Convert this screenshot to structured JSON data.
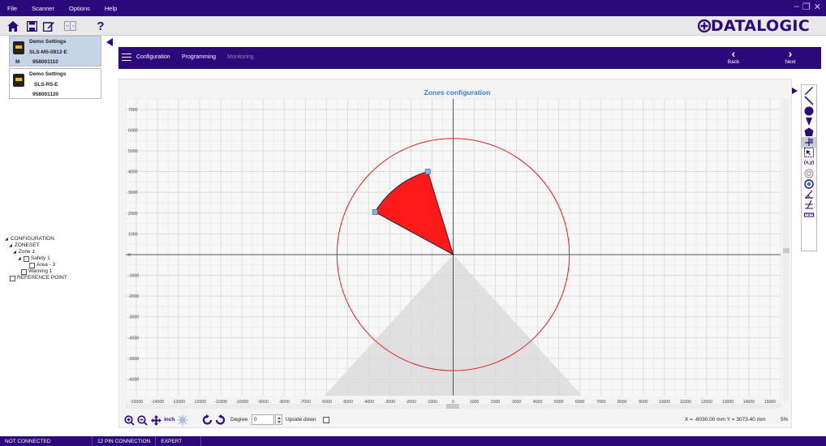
{
  "menubar": {
    "items": [
      "File",
      "Scanner",
      "Options",
      "Help"
    ],
    "window_controls": [
      "–",
      "❐",
      "✕"
    ]
  },
  "toolbar": {
    "buttons": [
      "home-icon",
      "save-icon",
      "edit-icon",
      "compare-icon",
      "help-icon"
    ],
    "help_glyph": "?"
  },
  "logo": {
    "text": "DATALOGIC"
  },
  "devices": [
    {
      "name": "Demo Settings",
      "model": "SLS-M5-0812-E",
      "serial": "958001110",
      "badge": "M"
    },
    {
      "name": "Demo Settings",
      "model": "SLS-R5-E",
      "serial": "958001120",
      "badge": ""
    }
  ],
  "tree": {
    "root": "CONFIGURATION",
    "zoneset": "ZONESET",
    "zone": "Zone 1",
    "safety": "Safety 1",
    "area": "Area - 3",
    "warning": "Warning 1",
    "reference": "REFERENCE POINT"
  },
  "nav": {
    "tabs": [
      {
        "label": "Configuration",
        "enabled": true
      },
      {
        "label": "Programming",
        "enabled": true
      },
      {
        "label": "Monitoring",
        "enabled": false
      }
    ],
    "back_label": "Back",
    "next_label": "Next"
  },
  "chart_data": {
    "type": "scatter",
    "title": "Zones configuration",
    "xlabel": "",
    "ylabel": "",
    "xlim": [
      -15500,
      15500
    ],
    "ylim": [
      -6800,
      7500
    ],
    "grid": true,
    "x_ticks": [
      -15000,
      -14000,
      -13000,
      -12000,
      -11000,
      -10000,
      -9000,
      -8000,
      -7000,
      -6000,
      -5000,
      -4000,
      -3000,
      -2000,
      -1000,
      0,
      1000,
      2000,
      3000,
      4000,
      5000,
      6000,
      7000,
      8000,
      9000,
      10000,
      11000,
      12000,
      13000,
      14000,
      15000
    ],
    "y_ticks": [
      7000,
      6000,
      5000,
      4000,
      3000,
      2000,
      1000,
      0,
      -1000,
      -2000,
      -3000,
      -4000,
      -5000,
      -6000
    ],
    "x_tick_labels": [
      "-15000",
      "-14000",
      "-13000",
      "-12000",
      "-11000",
      "-10000",
      "-9000",
      "-8000",
      "-7000",
      "-6000",
      "-5000",
      "-4000",
      "-3000",
      "-2000",
      "-1000",
      "0",
      "1000",
      "2000",
      "3000",
      "4000",
      "5000",
      "6000",
      "7000",
      "8000",
      "9000",
      "10000",
      "11000",
      "12000",
      "13000",
      "14000",
      "15000"
    ],
    "y_tick_labels": [
      "7000",
      "6000",
      "5000",
      "4000",
      "3000",
      "2000",
      "1000",
      "0",
      "-1000",
      "-2000",
      "-3000",
      "-4000",
      "-5000",
      "-6000"
    ],
    "shapes": {
      "range_circle": {
        "center": [
          0,
          0
        ],
        "radius": 5500,
        "color": "#e02020"
      },
      "blind_zone": {
        "points": [
          [
            0,
            0
          ],
          [
            -6100,
            -6800
          ],
          [
            6100,
            -6800
          ]
        ],
        "color": "#d8d8d8"
      },
      "safety_sector": {
        "center": [
          0,
          0
        ],
        "p1": [
          -3700,
          2050
        ],
        "p2": [
          -1200,
          4000
        ],
        "color": "#ff1a1a"
      }
    },
    "handles": [
      [
        -3700,
        2050
      ],
      [
        -1200,
        4000
      ]
    ]
  },
  "tools": [
    "pen-icon",
    "line-icon",
    "circle-icon",
    "sector-icon",
    "polygon-icon",
    "ruler-icon",
    "select-icon",
    "coordinates-icon",
    "scan-icon",
    "scan-fill-icon",
    "angle-icon",
    "angle2-icon",
    "measure-icon"
  ],
  "tools_coords_label": "(x,y)",
  "bottom": {
    "unit_label": "inch",
    "degree_label": "Degree",
    "degree_value": "0",
    "upside_label": "Upside down",
    "coords": "X = -8030.00 mm  Y = 3073.40 mm",
    "zoom_percent": "5%"
  },
  "status": {
    "connection": "NOT CONNECTED",
    "pin": "12 PIN CONNECTION",
    "mode": "EXPERT"
  },
  "colors": {
    "brand": "#2a0a7a",
    "zone_red": "#ff1a1a",
    "circle_red": "#e02020",
    "blind_grey": "#d8d8d8",
    "title_blue": "#3c7fc0"
  }
}
